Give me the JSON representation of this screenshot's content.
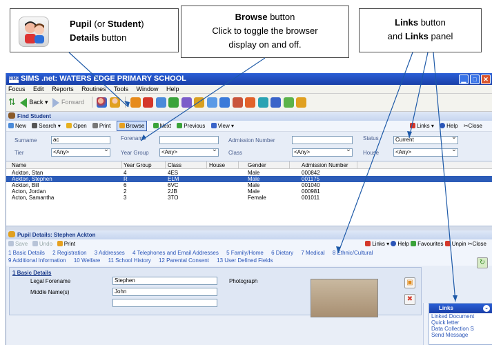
{
  "callouts": {
    "pupil": {
      "bold1": "Pupil",
      "mid": " (or ",
      "bold2": "Student",
      "close": ")",
      "bold3": "Details",
      "rest": " button"
    },
    "browse": {
      "bold": "Browse",
      "rest": " button",
      "line2": "Click to toggle the browser",
      "line3": "display on and off."
    },
    "links": {
      "bold1": "Links",
      "rest1": " button",
      "and": "and ",
      "bold2": "Links",
      "rest2": " panel"
    }
  },
  "app": {
    "title": "SIMS .net: WATERS EDGE PRIMARY SCHOOL",
    "logo": "SIMS",
    "menu": [
      "Focus",
      "Edit",
      "Reports",
      "Routines",
      "Tools",
      "Window",
      "Help"
    ],
    "nav": {
      "back": "Back",
      "forward": "Forward"
    }
  },
  "find": {
    "title": "Find Student",
    "toolbar": {
      "new": "New",
      "search": "Search",
      "open": "Open",
      "print": "Print",
      "browse": "Browse",
      "next": "Next",
      "previous": "Previous",
      "view": "View",
      "links": "Links",
      "help": "Help",
      "close": "Close"
    },
    "form": {
      "surname_label": "Surname",
      "surname_value": "ac",
      "forename_label": "Forename",
      "forename_value": "",
      "admission_label": "Admission Number",
      "admission_value": "",
      "status_label": "Status",
      "status_value": "Current",
      "tier_label": "Tier",
      "tier_value": "<Any>",
      "yeargroup_label": "Year Group",
      "yeargroup_value": "<Any>",
      "class_label": "Class",
      "class_value": "<Any>",
      "house_label": "House",
      "house_value": "<Any>"
    },
    "columns": [
      "Name",
      "Year Group",
      "Class",
      "House",
      "Gender",
      "Admission Number"
    ],
    "rows": [
      {
        "name": "Ackton, Stan",
        "year": "4",
        "class": "4ES",
        "house": "",
        "gender": "Male",
        "adm": "000842"
      },
      {
        "name": "Ackton, Stephen",
        "year": "R",
        "class": "ELM",
        "house": "",
        "gender": "Male",
        "adm": "001175"
      },
      {
        "name": "Ackton, Bill",
        "year": "6",
        "class": "6VC",
        "house": "",
        "gender": "Male",
        "adm": "001040"
      },
      {
        "name": "Acton, Jordan",
        "year": "2",
        "class": "2JB",
        "house": "",
        "gender": "Male",
        "adm": "000981"
      },
      {
        "name": "Acton, Samantha",
        "year": "3",
        "class": "3TO",
        "house": "",
        "gender": "Female",
        "adm": "001011"
      }
    ]
  },
  "details": {
    "title": "Pupil Details: Stephen Ackton",
    "toolbar": {
      "save": "Save",
      "undo": "Undo",
      "print": "Print",
      "links": "Links",
      "help": "Help",
      "favourites": "Favourites",
      "unpin": "Unpin",
      "close": "Close"
    },
    "tabs_row1": [
      "1 Basic Details",
      "2 Registration",
      "3 Addresses",
      "4 Telephones and Email Addresses",
      "5 Family/Home",
      "6 Dietary",
      "7 Medical",
      "8 Ethnic/Cultural"
    ],
    "tabs_row2": [
      "9 Additional Information",
      "10 Welfare",
      "11 School History",
      "12 Parental Consent",
      "13 User Defined Fields"
    ],
    "section_title": "1 Basic Details",
    "legal_forename_label": "Legal Forename",
    "legal_forename_value": "Stephen",
    "middle_label": "Middle Name(s)",
    "middle_value": "John",
    "photo_label": "Photograph"
  },
  "links_panel": {
    "title": "Links",
    "items": [
      "Linked Document",
      "Quick letter",
      "Data Collection S",
      "Send Message"
    ]
  }
}
